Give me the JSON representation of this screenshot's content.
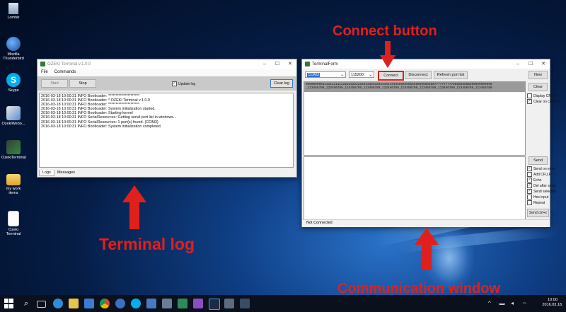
{
  "desktop": {
    "icons": [
      {
        "label": "Lomtár",
        "icon": "recycle-bin-icon"
      },
      {
        "label": "Mozilla Thunderbird",
        "icon": "thunderbird-icon"
      },
      {
        "label": "Skype",
        "icon": "skype-icon"
      },
      {
        "label": "OzekiWebo...",
        "icon": "ozeki-web-icon"
      },
      {
        "label": "OzekiTerminal",
        "icon": "ozeki-terminal-icon"
      },
      {
        "label": "my work items",
        "icon": "folder-icon"
      },
      {
        "label": "Ozeki Terminal",
        "icon": "document-icon"
      }
    ]
  },
  "terminal_window": {
    "title": "OZEKI Terminal v.1.0.0",
    "menu": [
      "File",
      "Commands"
    ],
    "start_label": "Start",
    "stop_label": "Stop",
    "update_log_label": "Update log",
    "update_log_checked": true,
    "clear_log_label": "Clear log",
    "log_lines": [
      "2016-03-18 10:00:31 INFO Bootloader: *********************",
      "2016-03-18 10:00:31 INFO Bootloader: * OZEKI Terminal v.1.0.0",
      "2016-03-18 10:00:31 INFO Bootloader: *********************",
      "2016-03-18 10:00:31 INFO Bootloader: System initialization started.",
      "2016-03-18 10:00:31 INFO Bootloader: Starting kernel",
      "2016-03-18 10:00:31 INFO SerialResources: Getting serial port list in windows...",
      "2016-03-18 10:00:31 INFO SerialResources: 1 port(s) found. (COM3)",
      "2016-03-18 10:00:31 INFO Bootloader: System initialization completed."
    ],
    "tabs": [
      "Logs",
      "Messages"
    ]
  },
  "terminal_form": {
    "title": "TerminalForm",
    "port_value": "COM3",
    "baud_value": "115200",
    "connect_label": "Connect",
    "disconnect_label": "Disconnect",
    "refresh_label": "Refresh port list",
    "new_label": "New",
    "clear_label": "Clear",
    "display_crlf_label": "Display CR/LF",
    "clear_on_connect_label": "Clear on connect",
    "output_line1": "0000000001111111111222222222233333333334444444444555555555566666666667777777777888888888899999999999",
    "output_line2": "_123456789_123456789_123456789_123456789_123456789_123456789_123456789_123456789_123456789_123456789",
    "send_label": "Send",
    "send_options": [
      {
        "label": "Send on enter",
        "checked": true
      },
      {
        "label": "Add CR,LF",
        "checked": false
      },
      {
        "label": "Echo",
        "checked": true
      },
      {
        "label": "Del after send",
        "checked": true
      },
      {
        "label": "Send selected",
        "checked": true
      },
      {
        "label": "Hex input",
        "checked": false
      },
      {
        "label": "Repeat",
        "checked": false
      }
    ],
    "send_ctrlz_label": "Send ctrl+z",
    "status": "Not Connected"
  },
  "annotations": {
    "connect": "Connect button",
    "terminal_log": "Terminal log",
    "communication": "Communication window",
    "color": "#e0201c"
  },
  "taskbar": {
    "time": "10:00",
    "date": "2016.03.18."
  }
}
